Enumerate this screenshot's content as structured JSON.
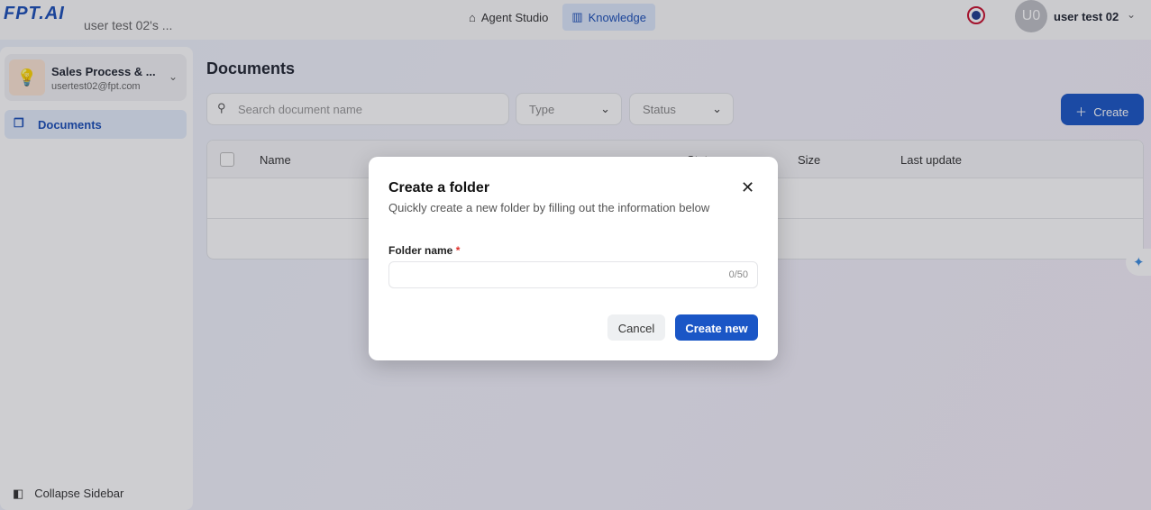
{
  "header": {
    "logo": "FPT.AI",
    "workspace": "user test 02's ...",
    "nav": [
      {
        "label": "Agent Studio",
        "icon": "robot-icon",
        "active": false
      },
      {
        "label": "Knowledge",
        "icon": "book-icon",
        "active": true
      }
    ],
    "avatar": "U0",
    "user": "user test 02"
  },
  "sidebar": {
    "project": {
      "title": "Sales Process & ...",
      "email": "usertest02@fpt.com"
    },
    "items": [
      {
        "label": "Documents"
      }
    ],
    "collapse": "Collapse Sidebar"
  },
  "main": {
    "title": "Documents",
    "search_placeholder": "Search document name",
    "type": "Type",
    "status": "Status",
    "create": "Create",
    "columns": [
      "Name",
      "Status",
      "Size",
      "Last update"
    ]
  },
  "modal": {
    "title": "Create a folder",
    "subtitle": "Quickly create a new folder by filling out the information below",
    "field_label": "Folder name",
    "required": "*",
    "value": "",
    "counter": "0/50",
    "cancel": "Cancel",
    "submit": "Create new"
  },
  "colors": {
    "primary": "#1a56c6"
  }
}
